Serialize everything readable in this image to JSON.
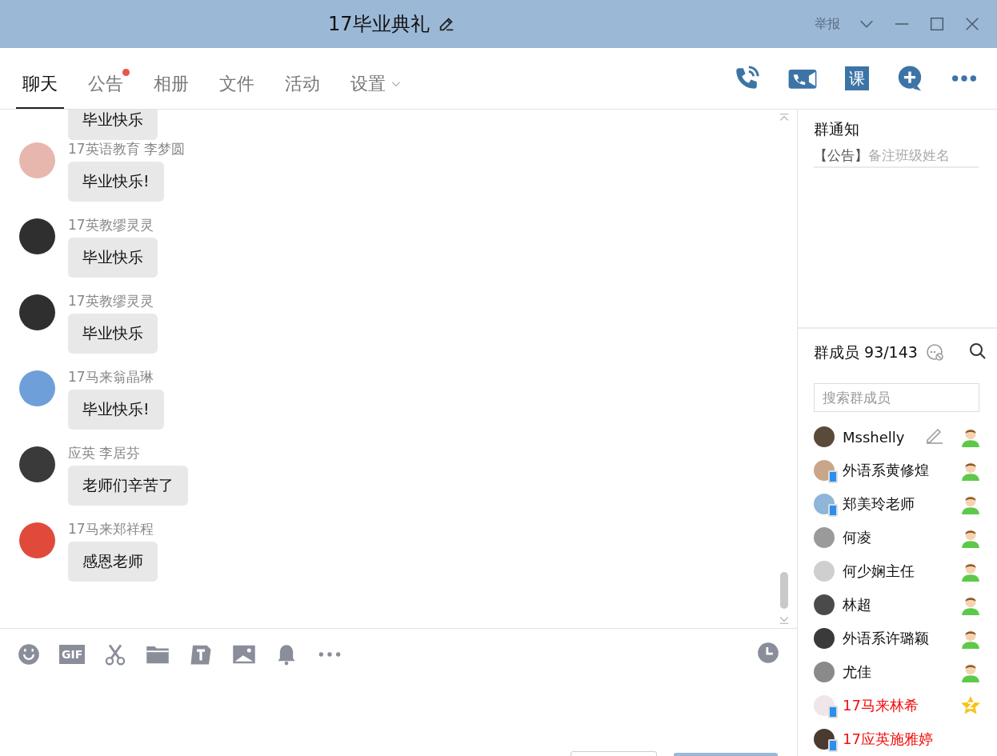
{
  "window": {
    "title": "17毕业典礼",
    "report": "举报"
  },
  "tabs": [
    {
      "label": "聊天",
      "selected": true,
      "dot": false,
      "dropdown": false
    },
    {
      "label": "公告",
      "selected": false,
      "dot": true,
      "dropdown": false
    },
    {
      "label": "相册",
      "selected": false,
      "dot": false,
      "dropdown": false
    },
    {
      "label": "文件",
      "selected": false,
      "dot": false,
      "dropdown": false
    },
    {
      "label": "活动",
      "selected": false,
      "dot": false,
      "dropdown": false
    },
    {
      "label": "设置",
      "selected": false,
      "dot": false,
      "dropdown": true
    }
  ],
  "toolbar": {
    "course_label": "课"
  },
  "messages": [
    {
      "text": "毕业快乐"
    },
    {
      "sender": "17英语教育 李梦圆",
      "color": "#e7b7ad",
      "text": "毕业快乐!"
    },
    {
      "sender": "17英教缪灵灵",
      "color": "#2f2f2f",
      "text": "毕业快乐"
    },
    {
      "sender": "17英教缪灵灵",
      "color": "#2f2f2f",
      "text": "毕业快乐"
    },
    {
      "sender": "17马来翁晶琳",
      "color": "#6f9fd8",
      "text": "毕业快乐!"
    },
    {
      "sender": "应英 李居芬",
      "color": "#3a3a3a",
      "text": "老师们辛苦了"
    },
    {
      "sender": "17马来郑祥程",
      "color": "#e04a3a",
      "text": "感恩老师"
    }
  ],
  "input_toolbar": {
    "gif_label": "GIF"
  },
  "notice": {
    "title": "群通知",
    "tag": "【公告】",
    "text": "备注班级姓名"
  },
  "members": {
    "title": "群成员 93/143",
    "search": {
      "placeholder": "搜索群成员"
    },
    "items": [
      {
        "name": "Msshelly",
        "color": "#5a4a3a",
        "mobile": false,
        "editable": true,
        "highlighted": false,
        "kind": "person"
      },
      {
        "name": "外语系黄修煌",
        "color": "#c9a58a",
        "mobile": true,
        "editable": false,
        "highlighted": false,
        "kind": "person"
      },
      {
        "name": "郑美玲老师",
        "color": "#8fb5d8",
        "mobile": true,
        "editable": false,
        "highlighted": false,
        "kind": "person"
      },
      {
        "name": "何凌",
        "color": "#9a9a9a",
        "mobile": false,
        "editable": false,
        "highlighted": false,
        "kind": "person"
      },
      {
        "name": "何少娴主任",
        "color": "#cfcfcf",
        "mobile": false,
        "editable": false,
        "highlighted": false,
        "kind": "person"
      },
      {
        "name": "林超",
        "color": "#4a4a4a",
        "mobile": false,
        "editable": false,
        "highlighted": false,
        "kind": "person"
      },
      {
        "name": "外语系许璐颖",
        "color": "#3a3a3a",
        "mobile": false,
        "editable": false,
        "highlighted": false,
        "kind": "person"
      },
      {
        "name": "尤佳",
        "color": "#8a8a8a",
        "mobile": false,
        "editable": false,
        "highlighted": false,
        "kind": "person"
      },
      {
        "name": "17马来林希",
        "color": "#f0e6ea",
        "mobile": true,
        "editable": false,
        "highlighted": true,
        "kind": "star"
      },
      {
        "name": "17应英施雅婷",
        "color": "#4a3a30",
        "mobile": true,
        "editable": false,
        "highlighted": true,
        "kind": "none"
      }
    ]
  }
}
